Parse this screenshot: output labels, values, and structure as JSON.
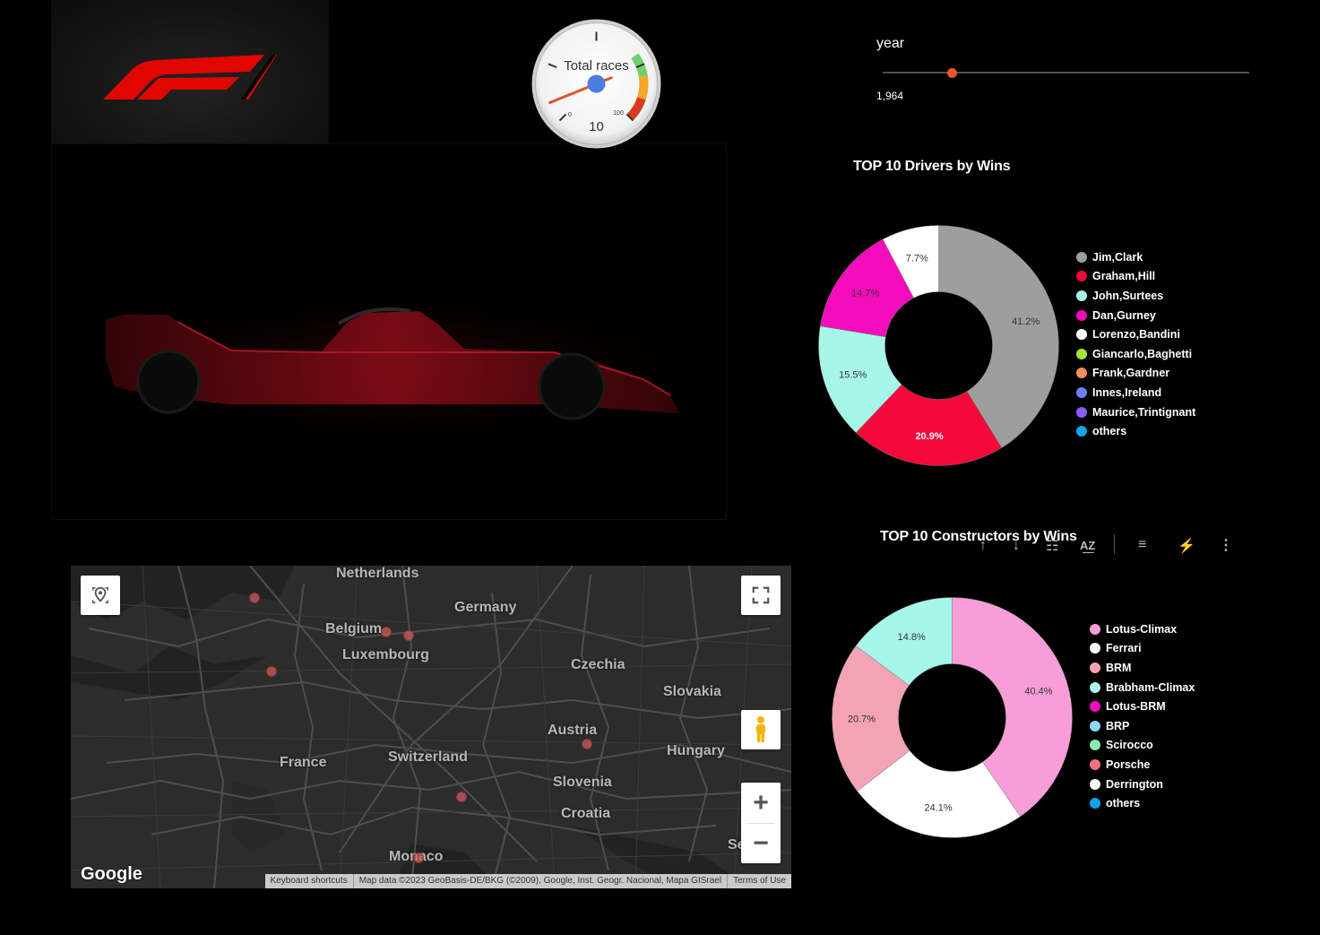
{
  "gauge": {
    "label": "Total races",
    "value": "10",
    "min_label": "0",
    "max_label": "100",
    "fraction": 0.1
  },
  "slider": {
    "label": "year",
    "value": "1,964",
    "fraction": 0.19
  },
  "drivers_chart": {
    "title": "TOP 10 Drivers by Wins",
    "legend": [
      "Jim,Clark",
      "Graham,Hill",
      "John,Surtees",
      "Dan,Gurney",
      "Lorenzo,Bandini",
      "Giancarlo,Baghetti",
      "Frank,Gardner",
      "Innes,Ireland",
      "Maurice,Trintignant",
      "others"
    ],
    "legend_colors": [
      "#9e9e9e",
      "#f5083a",
      "#a7f7e9",
      "#f50cba",
      "#ffffff",
      "#a3e635",
      "#f98c5f",
      "#6b7ff7",
      "#8b5cf6",
      "#0ea5e9"
    ]
  },
  "constructors_chart": {
    "title": "TOP 10 Constructors by Wins",
    "legend": [
      "Lotus-Climax",
      "Ferrari",
      "BRM",
      "Brabham-Climax",
      "Lotus-BRM",
      "BRP",
      "Scirocco",
      "Porsche",
      "Derrington",
      "others"
    ],
    "legend_colors": [
      "#f79ed9",
      "#ffffff",
      "#f4a3b4",
      "#a7f7e9",
      "#f50cba",
      "#8ed7f7",
      "#86efac",
      "#f07080",
      "#ffffff",
      "#0ea5e9"
    ]
  },
  "chart_data": [
    {
      "type": "pie",
      "title": "TOP 10 Drivers by Wins",
      "categories": [
        "Jim,Clark",
        "Graham,Hill",
        "John,Surtees",
        "Dan,Gurney",
        "Lorenzo,Bandini"
      ],
      "values": [
        41.2,
        20.9,
        15.5,
        14.7,
        7.7
      ],
      "labels": [
        "41.2%",
        "20.9%",
        "15.5%",
        "14.7%",
        "7.7%"
      ],
      "colors": [
        "#9e9e9e",
        "#f5083a",
        "#a7f7e9",
        "#f50cba",
        "#ffffff"
      ],
      "label_colors": [
        "#333",
        "#fff",
        "#333",
        "#333",
        "#333"
      ]
    },
    {
      "type": "pie",
      "title": "TOP 10 Constructors by Wins",
      "categories": [
        "Lotus-Climax",
        "Ferrari",
        "BRM",
        "Brabham-Climax"
      ],
      "values": [
        40.4,
        24.1,
        20.7,
        14.8
      ],
      "labels": [
        "40.4%",
        "24.1%",
        "20.7%",
        "14.8%"
      ],
      "colors": [
        "#f79ed9",
        "#ffffff",
        "#f4a3b4",
        "#a7f7e9"
      ],
      "label_colors": [
        "#333",
        "#333",
        "#333",
        "#333"
      ]
    }
  ],
  "map": {
    "labels": [
      "Netherlands",
      "Belgium",
      "Germany",
      "Luxembourg",
      "Czechia",
      "Slovakia",
      "Austria",
      "France",
      "Switzerland",
      "Hungary",
      "Slovenia",
      "Croatia",
      "Monaco",
      "Serbi"
    ],
    "logo": "Google",
    "footer": [
      "Keyboard shortcuts",
      "Map data ©2023 GeoBasis-DE/BKG (©2009), Google, Inst. Geogr. Nacional, Mapa GISrael",
      "Terms of Use"
    ]
  }
}
